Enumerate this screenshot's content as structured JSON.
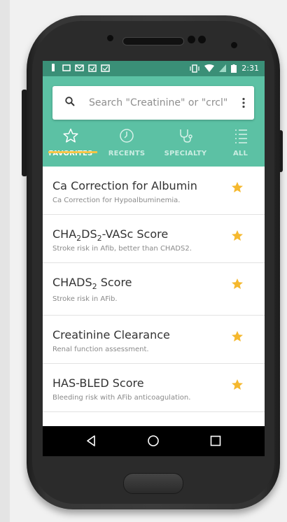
{
  "statusbar": {
    "time": "2:31"
  },
  "search": {
    "placeholder": "Search \"Creatinine\" or \"crcl\""
  },
  "tabs": [
    {
      "label": "FAVORITES",
      "icon": "star-outline-icon",
      "active": true
    },
    {
      "label": "RECENTS",
      "icon": "clock-icon",
      "active": false
    },
    {
      "label": "SPECIALTY",
      "icon": "stethoscope-icon",
      "active": false
    },
    {
      "label": "ALL",
      "icon": "list-icon",
      "active": false
    }
  ],
  "items": [
    {
      "title": "Ca Correction for Albumin",
      "description": "Ca Correction for Hypoalbuminemia."
    },
    {
      "title_parts": [
        "CHA",
        "2",
        "DS",
        "2",
        "-VASc Score"
      ],
      "description": "Stroke risk in Afib, better than CHADS2."
    },
    {
      "title_parts": [
        "CHADS",
        "2",
        " Score"
      ],
      "description": "Stroke risk in AFib."
    },
    {
      "title": "Creatinine Clearance",
      "description": "Renal function assessment."
    },
    {
      "title": "HAS-BLED Score",
      "description": "Bleeding risk with AFib anticoagulation."
    }
  ],
  "colors": {
    "statusbar": "#3a8f77",
    "appbar": "#5cc1a4",
    "star": "#f5b82e",
    "indicator": "#f5c445"
  },
  "navbar": {
    "icons": [
      "back-icon",
      "home-icon",
      "recents-icon"
    ]
  }
}
